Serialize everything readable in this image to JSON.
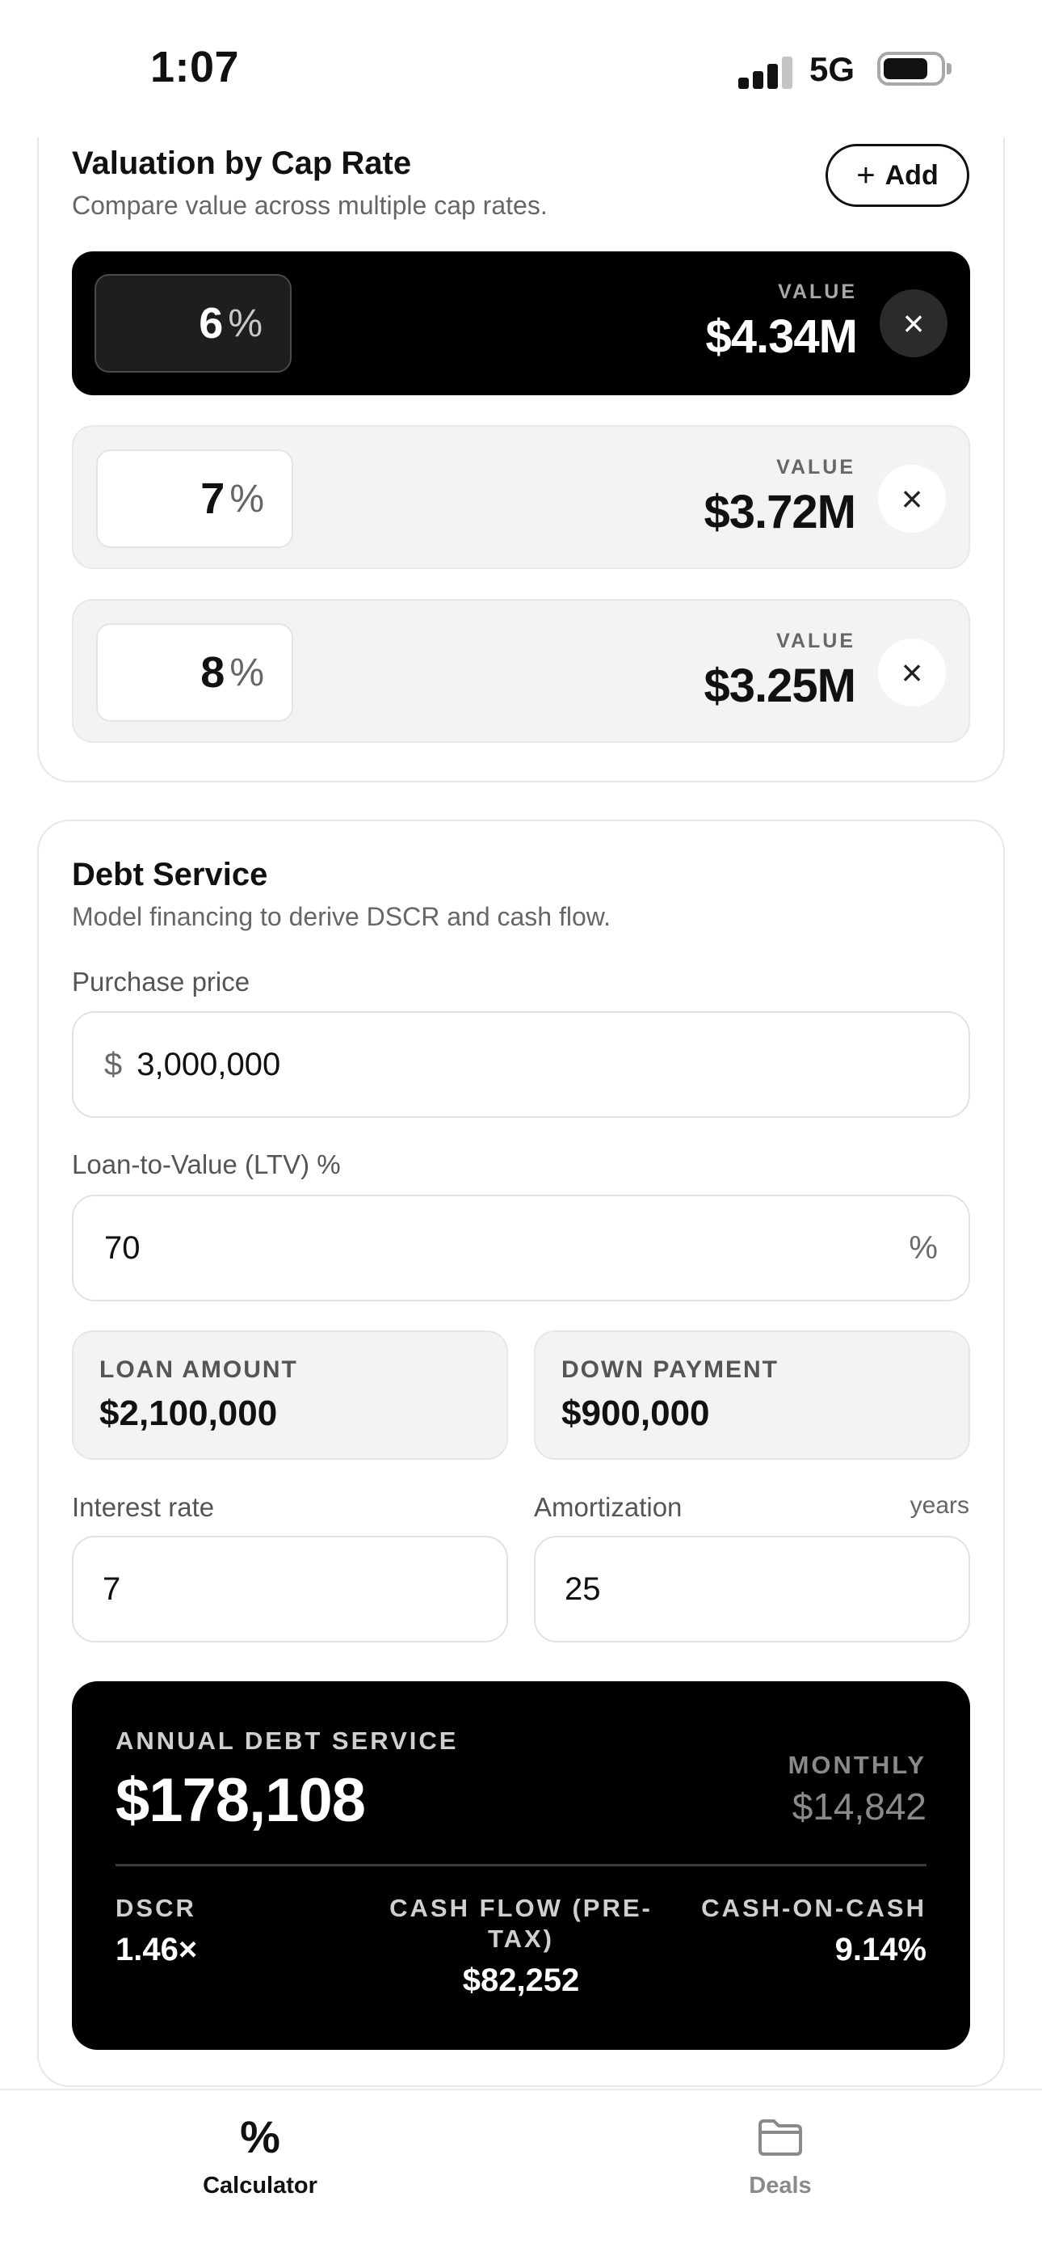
{
  "status_bar": {
    "time": "1:07",
    "network": "5G"
  },
  "cap_rate": {
    "title": "Valuation by Cap Rate",
    "subtitle": "Compare value across multiple cap rates.",
    "add_label": "Add",
    "rows": [
      {
        "rate": "6",
        "pct": "%",
        "value_label": "VALUE",
        "value": "$4.34M",
        "selected": true
      },
      {
        "rate": "7",
        "pct": "%",
        "value_label": "VALUE",
        "value": "$3.72M",
        "selected": false
      },
      {
        "rate": "8",
        "pct": "%",
        "value_label": "VALUE",
        "value": "$3.25M",
        "selected": false
      }
    ]
  },
  "debt": {
    "title": "Debt Service",
    "subtitle": "Model financing to derive DSCR and cash flow.",
    "purchase_label": "Purchase price",
    "purchase_prefix": "$",
    "purchase_value": "3,000,000",
    "ltv_label": "Loan-to-Value (LTV) %",
    "ltv_value": "70",
    "ltv_suffix": "%",
    "loan_amount_label": "LOAN AMOUNT",
    "loan_amount": "$2,100,000",
    "down_payment_label": "DOWN PAYMENT",
    "down_payment": "$900,000",
    "interest_label": "Interest rate",
    "interest_value": "7",
    "amortization_label": "Amortization",
    "amortization_unit": "years",
    "amortization_value": "25"
  },
  "summary": {
    "annual_label": "ANNUAL DEBT SERVICE",
    "annual_value": "$178,108",
    "monthly_label": "MONTHLY",
    "monthly_value": "$14,842",
    "dscr_label": "DSCR",
    "dscr_value": "1.46×",
    "cash_flow_label": "CASH FLOW (PRE-TAX)",
    "cash_flow_value": "$82,252",
    "coc_label": "CASH-ON-CASH",
    "coc_value": "9.14%"
  },
  "tabs": [
    {
      "label": "Calculator",
      "icon": "percent-icon",
      "active": true
    },
    {
      "label": "Deals",
      "icon": "folder-icon",
      "active": false
    }
  ]
}
